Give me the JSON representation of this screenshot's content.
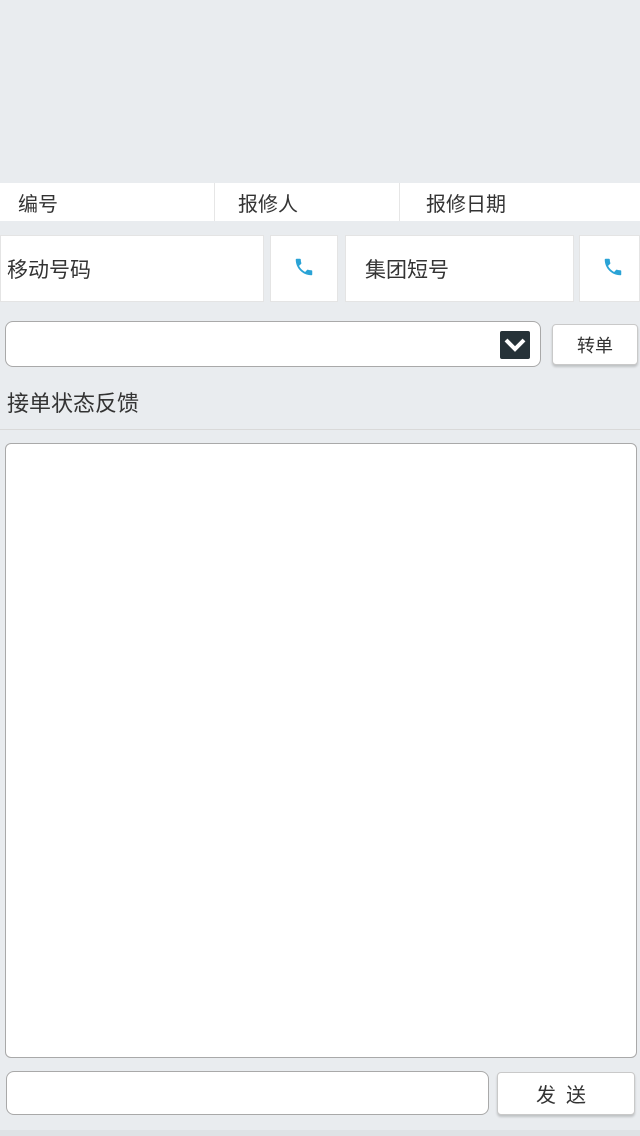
{
  "info_header": {
    "number_label": "编号",
    "reporter_label": "报修人",
    "date_label": "报修日期"
  },
  "contacts": {
    "mobile_label": "移动号码",
    "group_short_label": "集团短号",
    "call_icon": "phone-icon",
    "icon_color": "#2aa3d6"
  },
  "transfer": {
    "select_value": "",
    "button_label": "转单"
  },
  "feedback": {
    "section_title": "接单状态反馈",
    "content": ""
  },
  "composer": {
    "input_value": "",
    "send_label": "发送"
  }
}
